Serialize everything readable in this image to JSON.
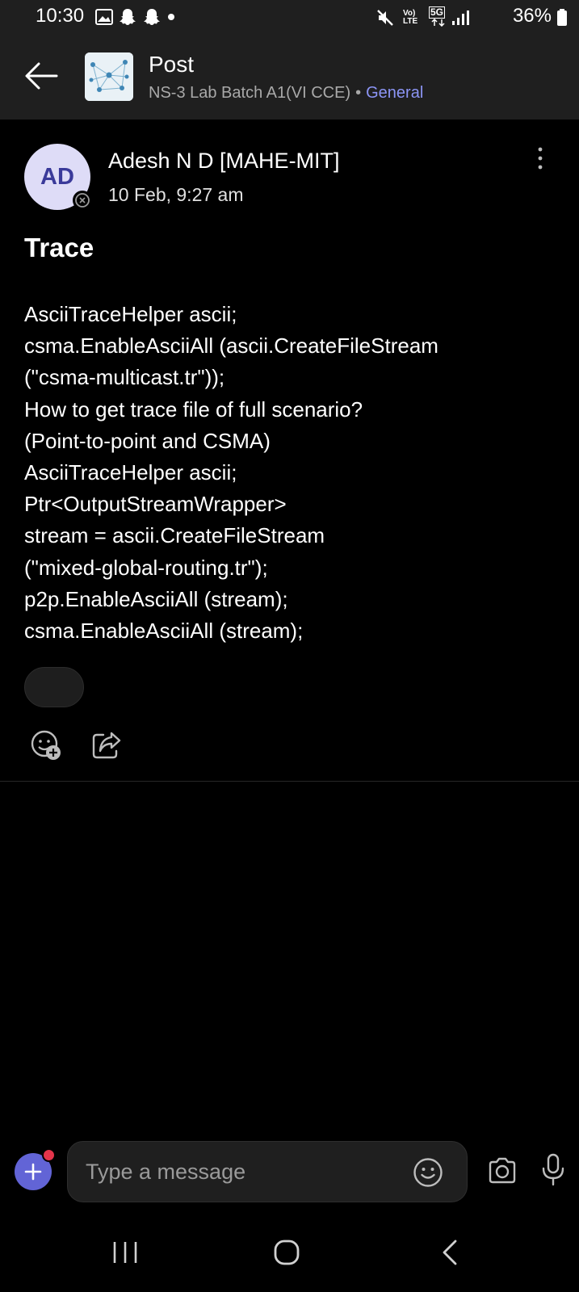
{
  "status_bar": {
    "time": "10:30",
    "battery": "36%",
    "network": "5G",
    "volte": "Vo) LTE"
  },
  "header": {
    "title": "Post",
    "team": "NS-3 Lab Batch A1(VI CCE)",
    "separator": "•",
    "channel": "General",
    "channel_color": "#8c95f5"
  },
  "post": {
    "avatar_initials": "AD",
    "author": "Adesh N D [MAHE-MIT]",
    "timestamp": "10 Feb, 9:27 am",
    "subject": "Trace",
    "body_lines": [
      "AsciiTraceHelper ascii;",
      "csma.EnableAsciiAll (ascii.CreateFileStream",
      "(\"csma-multicast.tr\"));",
      "How to get trace file of full scenario?",
      "(Point-to-point and CSMA)",
      "AsciiTraceHelper ascii;",
      "Ptr<OutputStreamWrapper>",
      "stream = ascii.CreateFileStream",
      "(\"mixed-global-routing.tr\");",
      "p2p.EnableAsciiAll (stream);",
      "csma.EnableAsciiAll (stream);"
    ]
  },
  "composer": {
    "placeholder": "Type a message",
    "accent": "#6264d6"
  },
  "icons": {
    "back": "arrow-left-icon",
    "more": "more-vertical-icon",
    "react": "add-reaction-icon",
    "share": "share-icon",
    "emoji": "emoji-icon",
    "camera": "camera-icon",
    "mic": "microphone-icon"
  }
}
